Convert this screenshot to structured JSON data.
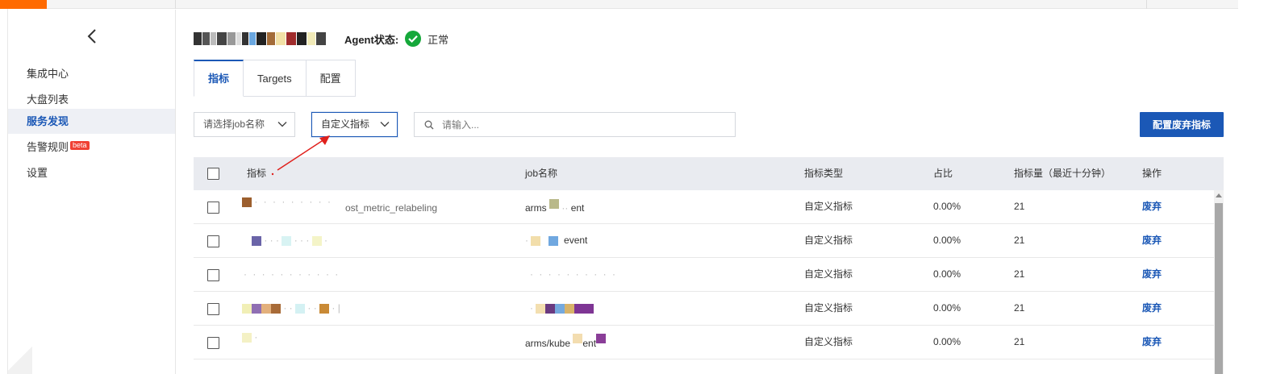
{
  "sidebar": {
    "items": [
      {
        "label": "集成中心"
      },
      {
        "label": "大盘列表"
      },
      {
        "label": "服务发现"
      },
      {
        "label": "告警规则"
      },
      {
        "label": "设置"
      }
    ],
    "beta_badge": "beta"
  },
  "header": {
    "agent_label": "Agent状态:",
    "agent_status": "正常"
  },
  "tabs": [
    {
      "label": "指标"
    },
    {
      "label": "Targets"
    },
    {
      "label": "配置"
    }
  ],
  "filters": {
    "job_select": "请选择job名称",
    "metric_select": "自定义指标",
    "search_placeholder": "请输入...",
    "config_button": "配置废弃指标"
  },
  "table": {
    "columns": [
      "指标",
      "job名称",
      "指标类型",
      "占比",
      "指标量（最近十分钟）",
      "操作"
    ],
    "rows": [
      {
        "metric_suffix": "ost_metric_relabeling",
        "job_prefix": "arms",
        "job_suffix": "ent",
        "type": "自定义指标",
        "ratio": "0.00%",
        "count": "21",
        "action": "废弃"
      },
      {
        "metric_suffix": "",
        "job_prefix": "",
        "job_suffix": "event",
        "type": "自定义指标",
        "ratio": "0.00%",
        "count": "21",
        "action": "废弃"
      },
      {
        "metric_suffix": "",
        "job_prefix": "",
        "job_suffix": "",
        "type": "自定义指标",
        "ratio": "0.00%",
        "count": "21",
        "action": "废弃"
      },
      {
        "metric_suffix": "",
        "job_prefix": "",
        "job_suffix": "",
        "type": "自定义指标",
        "ratio": "0.00%",
        "count": "21",
        "action": "废弃"
      },
      {
        "metric_suffix": "",
        "job_prefix": "arms/kube",
        "job_suffix": "ent",
        "type": "自定义指标",
        "ratio": "0.00%",
        "count": "21",
        "action": "废弃"
      }
    ]
  },
  "colors": {
    "primary": "#1b58b6",
    "success": "#15a83a",
    "badge": "#f04134",
    "annotation_arrow": "#e0201c"
  },
  "icons": {
    "back": "chevron-left-icon",
    "status": "check-circle-icon",
    "dropdown": "chevron-down-icon",
    "search": "search-icon"
  }
}
